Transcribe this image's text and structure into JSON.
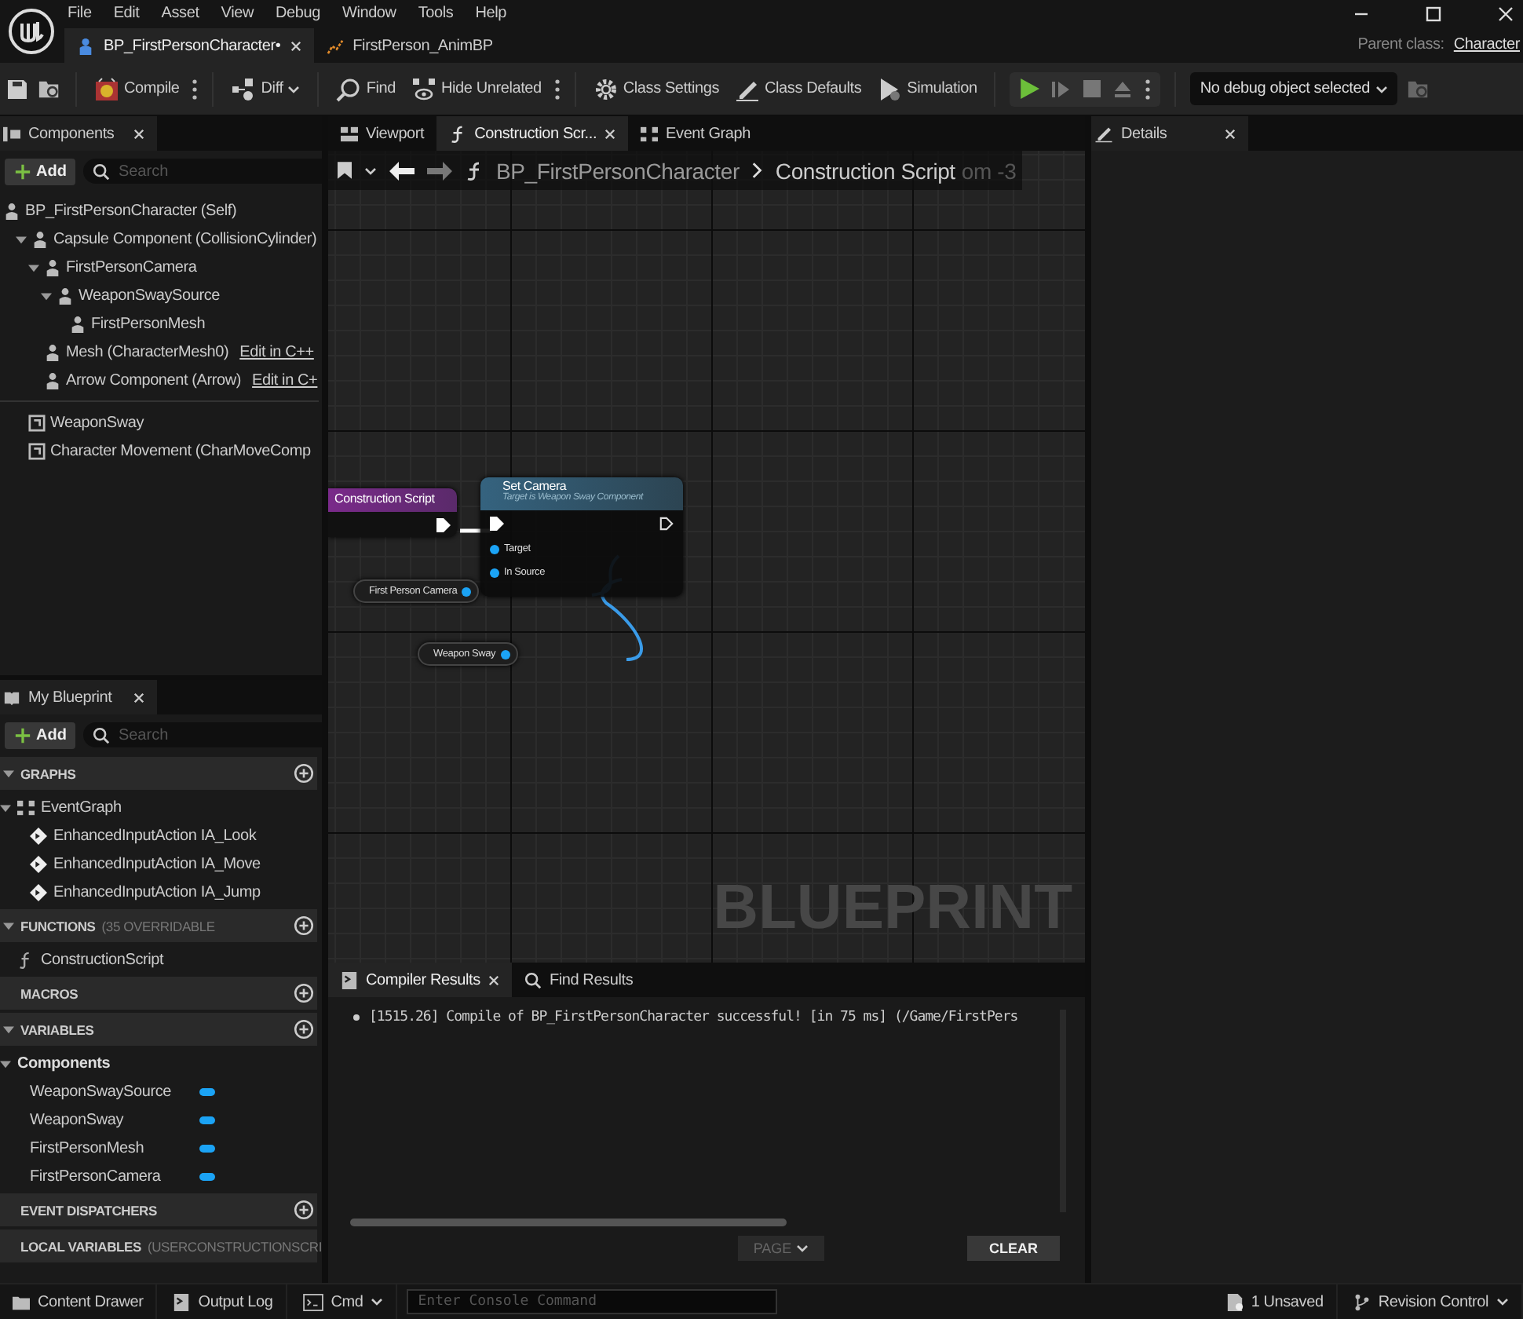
{
  "menu": [
    "File",
    "Edit",
    "Asset",
    "View",
    "Debug",
    "Window",
    "Tools",
    "Help"
  ],
  "asset_tabs": [
    {
      "label": "BP_FirstPersonCharacter•",
      "selected": true
    },
    {
      "label": "FirstPerson_AnimBP",
      "selected": false
    }
  ],
  "parent_class": {
    "label": "Parent class:",
    "value": "Character"
  },
  "toolbar_groups": [
    {
      "buttons": [
        {
          "label": "Compile",
          "more": true
        }
      ]
    },
    {
      "buttons": [
        {
          "label": "Diff",
          "dropdown": true
        }
      ]
    },
    {
      "buttons": [
        {
          "label": "Find"
        },
        {
          "label": "Hide Unrelated",
          "more": true
        }
      ]
    },
    {
      "buttons": [
        {
          "label": "Class Settings"
        },
        {
          "label": "Class Defaults"
        },
        {
          "label": "Simulation"
        }
      ]
    }
  ],
  "debug_object": {
    "value": "No debug object selected"
  },
  "components": {
    "title": "Components",
    "add": "Add",
    "search": {
      "placeholder": "Search"
    },
    "tree": [
      {
        "label": "BP_FirstPersonCharacter (Self)",
        "children": [
          {
            "label": "Capsule Component (CollisionCylinder)",
            "expanded": true,
            "children": [
              {
                "label": "FirstPersonCamera",
                "expanded": true,
                "children": [
                  {
                    "label": "WeaponSwaySource",
                    "expanded": true,
                    "children": [
                      {
                        "label": "FirstPersonMesh"
                      }
                    ]
                  }
                ]
              },
              {
                "label": "Mesh (CharacterMesh0)",
                "link": "Edit in C++"
              },
              {
                "label": "Arrow Component (Arrow)",
                "link": "Edit in C+"
              }
            ]
          }
        ]
      }
    ],
    "other": [
      {
        "label": "WeaponSway"
      },
      {
        "label": "Character Movement (CharMoveComp"
      }
    ]
  },
  "my_blueprint": {
    "title": "My Blueprint",
    "add": "Add",
    "search": {
      "placeholder": "Search"
    },
    "sections": [
      {
        "title": "GRAPHS",
        "expanded": true,
        "items": [
          {
            "label": "EventGraph",
            "kind": "graph",
            "expanded": true,
            "children": [
              {
                "label": "EnhancedInputAction IA_Look",
                "kind": "event"
              },
              {
                "label": "EnhancedInputAction IA_Move",
                "kind": "event"
              },
              {
                "label": "EnhancedInputAction IA_Jump",
                "kind": "event"
              }
            ]
          }
        ]
      },
      {
        "title": "FUNCTIONS",
        "note": "(35 OVERRIDABLE",
        "expanded": true,
        "items": [
          {
            "label": "ConstructionScript",
            "kind": "function"
          }
        ]
      },
      {
        "title": "MACROS"
      },
      {
        "title": "VARIABLES",
        "expanded": true,
        "items": [
          {
            "label": "Components",
            "kind": "category",
            "expanded": true,
            "children": [
              {
                "label": "WeaponSwaySource",
                "kind": "variable"
              },
              {
                "label": "WeaponSway",
                "kind": "variable"
              },
              {
                "label": "FirstPersonMesh",
                "kind": "variable"
              },
              {
                "label": "FirstPersonCamera",
                "kind": "variable"
              }
            ]
          }
        ]
      },
      {
        "title": "EVENT DISPATCHERS"
      },
      {
        "title": "LOCAL VARIABLES",
        "note": "(USERCONSTRUCTIONSCRI"
      }
    ]
  },
  "editor_tabs": [
    {
      "label": "Viewport",
      "selected": false
    },
    {
      "label": "Construction Scr...",
      "selected": true
    },
    {
      "label": "Event Graph",
      "selected": false
    }
  ],
  "breadcrumb": [
    "BP_FirstPersonCharacter",
    "Construction Script"
  ],
  "zoom_label": "om -3",
  "graph": {
    "watermark": "BLUEPRINT",
    "nodes": [
      {
        "kind": "entry",
        "title": "Construction Script"
      },
      {
        "kind": "function",
        "title": "Set Camera",
        "subtitle": "Target is Weapon Sway Component",
        "pins": [
          "Target",
          "In Source"
        ]
      },
      {
        "kind": "getter",
        "title": "First Person Camera"
      },
      {
        "kind": "getter",
        "title": "Weapon Sway"
      }
    ]
  },
  "results": {
    "tabs": [
      {
        "label": "Compiler Results",
        "selected": true
      },
      {
        "label": "Find Results",
        "selected": false
      }
    ],
    "messages": [
      "[1515.26] Compile of BP_FirstPersonCharacter successful! [in 75 ms] (/Game/FirstPers"
    ],
    "page": {
      "label": "PAGE",
      "disabled": true
    },
    "clear": "CLEAR"
  },
  "details": {
    "title": "Details"
  },
  "status_bar": {
    "buttons": [
      "Content Drawer",
      "Output Log"
    ],
    "cmd": "Cmd",
    "console": {
      "placeholder": "Enter Console Command"
    },
    "unsaved": "1 Unsaved",
    "revision": "Revision Control"
  }
}
